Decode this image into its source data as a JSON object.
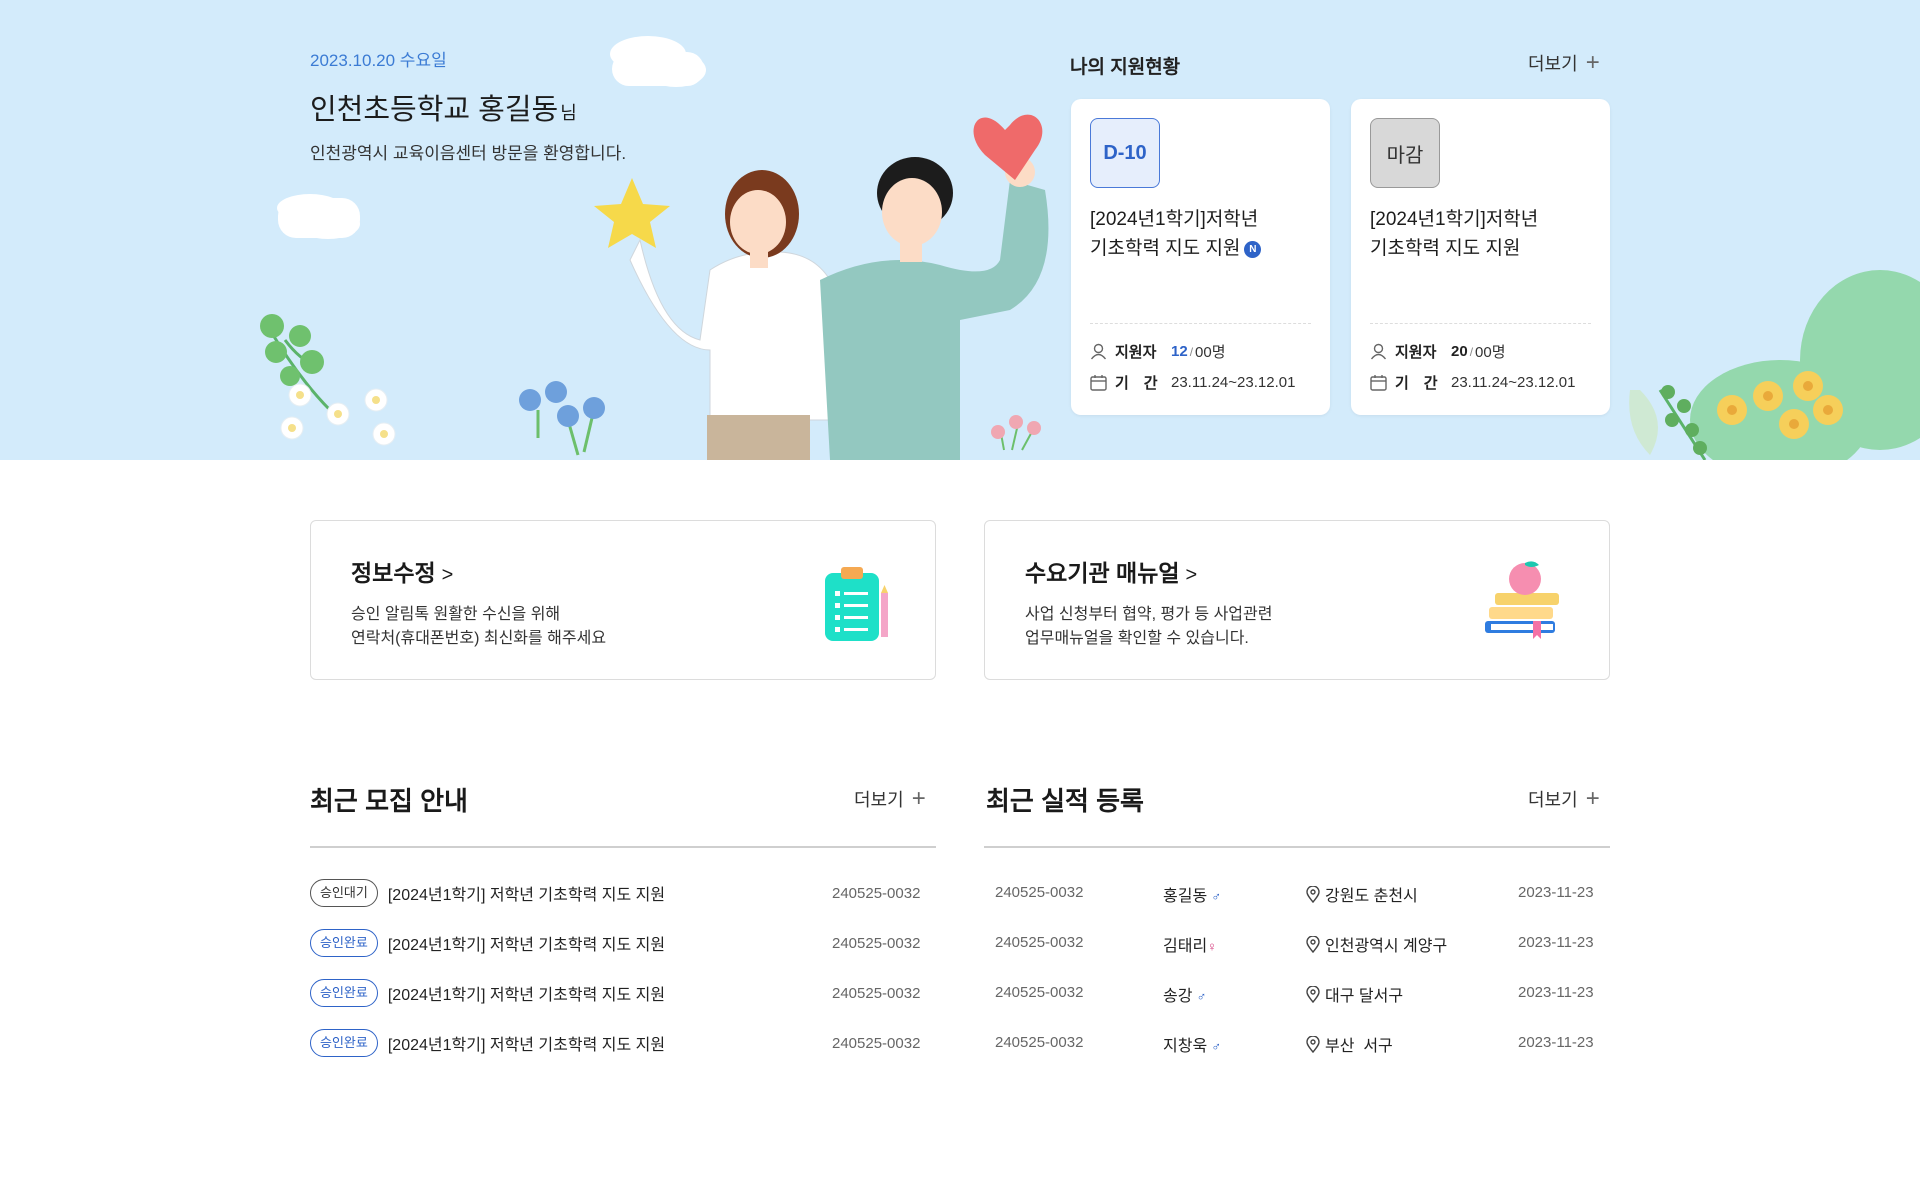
{
  "hero": {
    "date": "2023.10.20 수요일",
    "name": "인천초등학교 홍길동",
    "name_suffix": "님",
    "welcome": "인천광역시 교육이음센터 방문을 환영합니다."
  },
  "status": {
    "title": "나의 지원현황",
    "more_label": "더보기",
    "cards": [
      {
        "badge": "D-10",
        "title_line1": "[2024년1학기]저학년",
        "title_line2": "기초학력 지도 지원",
        "new_badge": "N",
        "applicant_label": "지원자",
        "applicant_count": "12",
        "applicant_total": "00명",
        "period_label": "기　간",
        "period": "23.11.24~23.12.01"
      },
      {
        "badge": "마감",
        "title_line1": "[2024년1학기]저학년",
        "title_line2": "기초학력 지도 지원",
        "applicant_label": "지원자",
        "applicant_count": "20",
        "applicant_total": "00명",
        "period_label": "기　간",
        "period": "23.11.24~23.12.01"
      }
    ]
  },
  "services": [
    {
      "title": "정보수정",
      "desc_line1": "승인 알림톡 원활한 수신을 위해",
      "desc_line2": "연락처(휴대폰번호) 최신화를 해주세요"
    },
    {
      "title": "수요기관 매뉴얼",
      "desc_line1": "사업 신청부터 협약, 평가 등 사업관련",
      "desc_line2": "업무매뉴얼을 확인할 수 있습니다."
    }
  ],
  "recruit": {
    "title": "최근 모집 안내",
    "more_label": "더보기",
    "rows": [
      {
        "status": "승인대기",
        "title": "[2024년1학기] 저학년 기초학력 지도 지원",
        "number": "240525-0032"
      },
      {
        "status": "승인완료",
        "title": "[2024년1학기] 저학년 기초학력 지도 지원",
        "number": "240525-0032"
      },
      {
        "status": "승인완료",
        "title": "[2024년1학기] 저학년 기초학력 지도 지원",
        "number": "240525-0032"
      },
      {
        "status": "승인완료",
        "title": "[2024년1학기] 저학년 기초학력 지도 지원",
        "number": "240525-0032"
      }
    ]
  },
  "performance": {
    "title": "최근 실적 등록",
    "more_label": "더보기",
    "rows": [
      {
        "number": "240525-0032",
        "name": "홍길동",
        "gender": "♂",
        "location": "강원도 춘천시",
        "date": "2023-11-23"
      },
      {
        "number": "240525-0032",
        "name": "김태리",
        "gender": "♀",
        "location": "인천광역시 계양구",
        "date": "2023-11-23"
      },
      {
        "number": "240525-0032",
        "name": "송강",
        "gender": "♂",
        "location": "대구 달서구",
        "date": "2023-11-23"
      },
      {
        "number": "240525-0032",
        "name": "지창욱",
        "gender": "♂",
        "location": "부산  서구",
        "date": "2023-11-23"
      }
    ]
  },
  "colors": {
    "hero_bg": "#d3ebfb",
    "accent": "#2e63c8",
    "female": "#d4377a"
  }
}
